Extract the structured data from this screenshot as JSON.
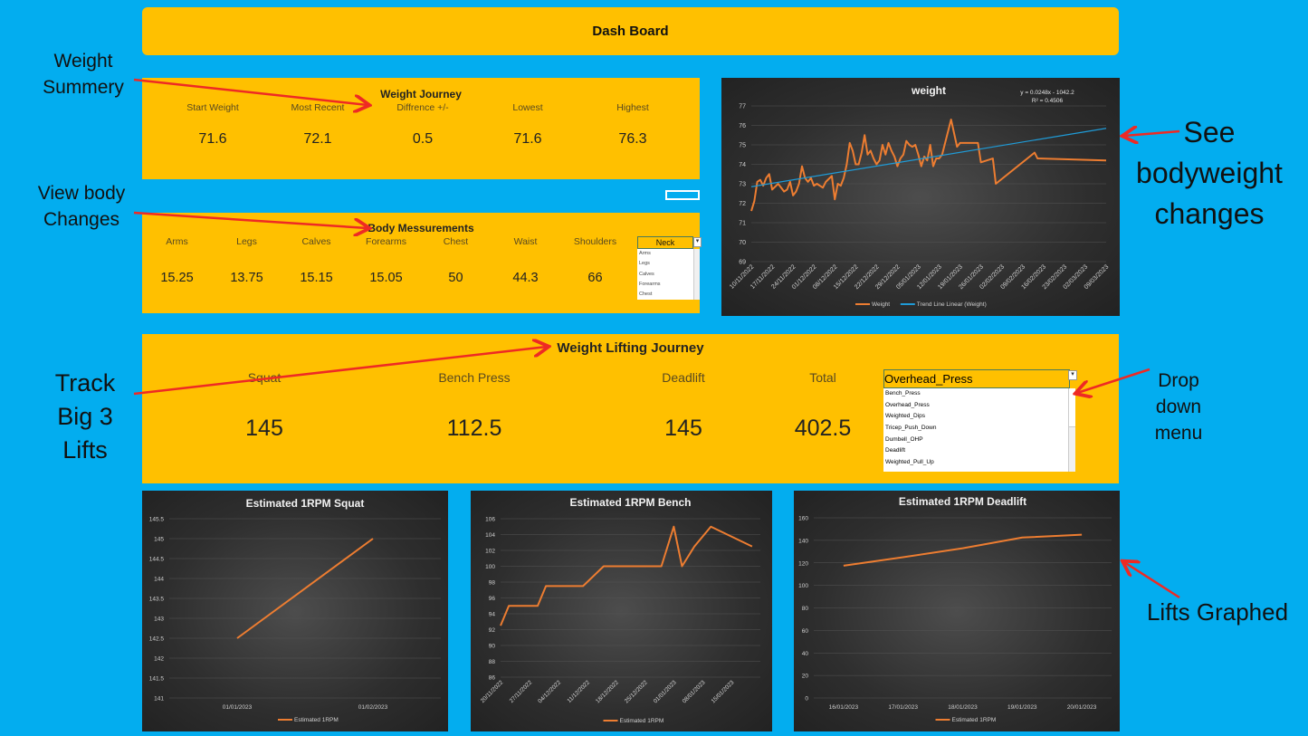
{
  "banner": {
    "title": "Dash Board"
  },
  "annotations": {
    "weight_summary": "Weight Summery",
    "body_changes": "View body Changes",
    "big3": "Track Big 3 Lifts",
    "bodyweight": "See bodyweight changes",
    "dropdown": "Drop down menu",
    "lifts_graphed": "Lifts Graphed",
    "arrow_color": "#ee2a24"
  },
  "weight_journey": {
    "title": "Weight Journey",
    "columns": [
      {
        "label": "Start Weight",
        "value": "71.6"
      },
      {
        "label": "Most Recent",
        "value": "72.1"
      },
      {
        "label": "Diffrence +/-",
        "value": "0.5"
      },
      {
        "label": "Lowest",
        "value": "71.6"
      },
      {
        "label": "Highest",
        "value": "76.3"
      }
    ]
  },
  "body_measurements": {
    "title": "Body Messurements",
    "columns": [
      {
        "label": "Arms",
        "value": "15.25"
      },
      {
        "label": "Legs",
        "value": "13.75"
      },
      {
        "label": "Calves",
        "value": "15.15"
      },
      {
        "label": "Forearms",
        "value": "15.05"
      },
      {
        "label": "Chest",
        "value": "50"
      },
      {
        "label": "Waist",
        "value": "44.3"
      },
      {
        "label": "Shoulders",
        "value": "66"
      }
    ],
    "dropdown": {
      "selected": "Neck",
      "options": [
        "Arms",
        "Legs",
        "Calves",
        "Forearms",
        "Chest"
      ]
    }
  },
  "lifting_journey": {
    "title": "Weight Lifting Journey",
    "columns": [
      {
        "label": "Squat",
        "value": "145"
      },
      {
        "label": "Bench Press",
        "value": "112.5"
      },
      {
        "label": "Deadlift",
        "value": "145"
      },
      {
        "label": "Total",
        "value": "402.5"
      }
    ],
    "dropdown": {
      "selected": "Overhead_Press",
      "options": [
        "Bench_Press",
        "Overhead_Press",
        "Weighted_Dips",
        "Tricep_Push_Down",
        "Dumbell_OHP",
        "Deadlift",
        "Weighted_Pull_Up"
      ],
      "highlighted": "Overhead_Press"
    }
  },
  "colors": {
    "panel": "#ffc000",
    "background": "#03adef",
    "series": "#ed7d31",
    "trend": "#1f9bd7"
  },
  "chart_data": [
    {
      "id": "weight",
      "type": "line",
      "title": "weight",
      "equation": "y = 0.0248x - 1042.2",
      "r_squared": "R² = 0.4506",
      "ylim": [
        69,
        77
      ],
      "yticks": [
        "69",
        "70",
        "71",
        "72",
        "73",
        "74",
        "75",
        "76",
        "77"
      ],
      "xaxis": "date",
      "xlim": [
        "10/11/2022",
        "09/03/2023"
      ],
      "xticks": [
        "10/11/2022",
        "17/11/2022",
        "24/11/2022",
        "01/12/2022",
        "08/12/2022",
        "15/12/2022",
        "22/12/2022",
        "29/12/2022",
        "05/01/2023",
        "12/01/2023",
        "19/01/2023",
        "26/01/2023",
        "02/02/2023",
        "09/02/2023",
        "16/02/2023",
        "23/02/2023",
        "02/03/2023",
        "09/03/2023"
      ],
      "grid": true,
      "legend": "bottom",
      "series": [
        {
          "name": "Weight",
          "color": "#ed7d31",
          "points": [
            [
              "10/11/2022",
              71.6
            ],
            [
              "11/11/2022",
              72.1
            ],
            [
              "12/11/2022",
              73.1
            ],
            [
              "13/11/2022",
              73.2
            ],
            [
              "14/11/2022",
              72.9
            ],
            [
              "15/11/2022",
              73.3
            ],
            [
              "16/11/2022",
              73.5
            ],
            [
              "17/11/2022",
              72.7
            ],
            [
              "19/11/2022",
              73.0
            ],
            [
              "21/11/2022",
              72.6
            ],
            [
              "22/11/2022",
              72.7
            ],
            [
              "23/11/2022",
              73.1
            ],
            [
              "24/11/2022",
              72.4
            ],
            [
              "25/11/2022",
              72.6
            ],
            [
              "26/11/2022",
              73.0
            ],
            [
              "27/11/2022",
              73.9
            ],
            [
              "28/11/2022",
              73.3
            ],
            [
              "29/11/2022",
              73.1
            ],
            [
              "30/11/2022",
              73.3
            ],
            [
              "01/12/2022",
              72.9
            ],
            [
              "02/12/2022",
              73.0
            ],
            [
              "04/12/2022",
              72.8
            ],
            [
              "05/12/2022",
              73.1
            ],
            [
              "07/12/2022",
              73.4
            ],
            [
              "08/12/2022",
              72.2
            ],
            [
              "09/12/2022",
              73.0
            ],
            [
              "10/12/2022",
              72.9
            ],
            [
              "11/12/2022",
              73.3
            ],
            [
              "12/12/2022",
              74.0
            ],
            [
              "13/12/2022",
              75.1
            ],
            [
              "14/12/2022",
              74.7
            ],
            [
              "15/12/2022",
              74.0
            ],
            [
              "16/12/2022",
              74.0
            ],
            [
              "17/12/2022",
              74.6
            ],
            [
              "18/12/2022",
              75.5
            ],
            [
              "19/12/2022",
              74.5
            ],
            [
              "20/12/2022",
              74.7
            ],
            [
              "21/12/2022",
              74.3
            ],
            [
              "22/12/2022",
              74.0
            ],
            [
              "23/12/2022",
              74.2
            ],
            [
              "24/12/2022",
              75.0
            ],
            [
              "25/12/2022",
              74.5
            ],
            [
              "26/12/2022",
              75.1
            ],
            [
              "27/12/2022",
              74.7
            ],
            [
              "28/12/2022",
              74.4
            ],
            [
              "29/12/2022",
              73.9
            ],
            [
              "30/12/2022",
              74.3
            ],
            [
              "31/12/2022",
              74.5
            ],
            [
              "01/01/2023",
              75.2
            ],
            [
              "02/01/2023",
              75.0
            ],
            [
              "03/01/2023",
              74.9
            ],
            [
              "04/01/2023",
              75.0
            ],
            [
              "05/01/2023",
              74.5
            ],
            [
              "06/01/2023",
              73.9
            ],
            [
              "07/01/2023",
              74.4
            ],
            [
              "08/01/2023",
              74.2
            ],
            [
              "09/01/2023",
              75.0
            ],
            [
              "10/01/2023",
              73.9
            ],
            [
              "11/01/2023",
              74.3
            ],
            [
              "12/01/2023",
              74.3
            ],
            [
              "13/01/2023",
              74.5
            ],
            [
              "16/01/2023",
              76.3
            ],
            [
              "18/01/2023",
              74.9
            ],
            [
              "19/01/2023",
              75.1
            ],
            [
              "25/01/2023",
              75.1
            ],
            [
              "26/01/2023",
              74.1
            ],
            [
              "30/01/2023",
              74.3
            ],
            [
              "31/01/2023",
              73.0
            ],
            [
              "13/02/2023",
              74.6
            ],
            [
              "14/02/2023",
              74.3
            ],
            [
              "09/03/2023",
              74.2
            ]
          ]
        },
        {
          "name": "Trend Line Linear (Weight)",
          "color": "#1f9bd7",
          "points": [
            [
              "10/11/2022",
              72.85
            ],
            [
              "09/03/2023",
              75.85
            ]
          ]
        }
      ]
    },
    {
      "id": "squat",
      "type": "line",
      "title": "Estimated 1RPM Squat",
      "ylim": [
        141,
        145.5
      ],
      "yticks": [
        "141",
        "141.5",
        "142",
        "142.5",
        "143",
        "143.5",
        "144",
        "144.5",
        "145",
        "145.5"
      ],
      "xaxis": "category",
      "categories": [
        "01/01/2023",
        "01/02/2023"
      ],
      "grid": true,
      "legend": "bottom",
      "series": [
        {
          "name": "Estimated 1RPM",
          "color": "#ed7d31",
          "values": [
            142.5,
            145
          ]
        }
      ]
    },
    {
      "id": "bench",
      "type": "line",
      "title": "Estimated 1RPM Bench",
      "ylim": [
        86,
        106
      ],
      "yticks": [
        "86",
        "88",
        "90",
        "92",
        "94",
        "96",
        "98",
        "100",
        "102",
        "104",
        "106"
      ],
      "xaxis": "date",
      "xlim": [
        "20/11/2022",
        "22/01/2023"
      ],
      "xticks": [
        "20/11/2022",
        "27/11/2022",
        "04/12/2022",
        "11/12/2022",
        "18/12/2022",
        "25/12/2022",
        "01/01/2023",
        "08/01/2023",
        "15/01/2023"
      ],
      "grid": true,
      "legend": "bottom",
      "series": [
        {
          "name": "Estimated 1RPM",
          "color": "#ed7d31",
          "points": [
            [
              "20/11/2022",
              92.5
            ],
            [
              "22/11/2022",
              95
            ],
            [
              "29/11/2022",
              95
            ],
            [
              "01/12/2022",
              97.5
            ],
            [
              "10/12/2022",
              97.5
            ],
            [
              "15/12/2022",
              100
            ],
            [
              "29/12/2022",
              100
            ],
            [
              "01/01/2023",
              105
            ],
            [
              "03/01/2023",
              100
            ],
            [
              "06/01/2023",
              102.5
            ],
            [
              "10/01/2023",
              105
            ],
            [
              "20/01/2023",
              102.5
            ]
          ]
        }
      ]
    },
    {
      "id": "deadlift",
      "type": "line",
      "title": "Estimated 1RPM Deadlift",
      "ylim": [
        0,
        160
      ],
      "yticks": [
        "0",
        "20",
        "40",
        "60",
        "80",
        "100",
        "120",
        "140",
        "160"
      ],
      "xaxis": "category",
      "categories": [
        "16/01/2023",
        "17/01/2023",
        "18/01/2023",
        "19/01/2023",
        "20/01/2023"
      ],
      "grid": true,
      "legend": "bottom",
      "series": [
        {
          "name": "Estimated 1RPM",
          "color": "#ed7d31",
          "values": [
            117.5,
            125,
            133,
            142.5,
            145
          ]
        }
      ]
    }
  ]
}
